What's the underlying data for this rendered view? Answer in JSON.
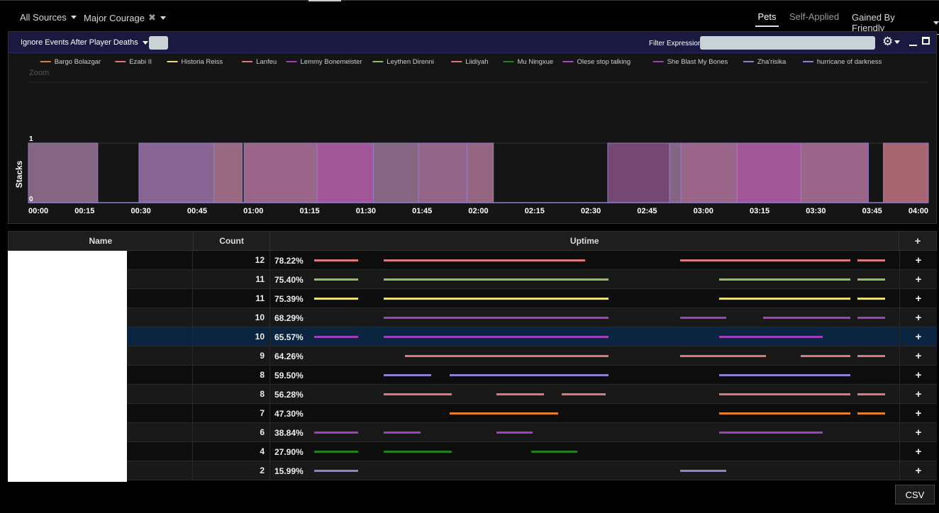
{
  "topbar": {
    "sources_label": "All Sources",
    "aura_label": "Major Courage",
    "tab_pets": "Pets",
    "tab_self_applied": "Self-Applied",
    "gained_label": "Gained By Friendly"
  },
  "panel": {
    "ignore_label": "Ignore Events After Player Deaths",
    "filter_label": "Filter Expression:",
    "filter_value": ""
  },
  "chart_data": {
    "type": "area",
    "zoom_label": "Zoom",
    "ylabel": "Stacks",
    "ylim": [
      0,
      1
    ],
    "y_ticks": [
      "0",
      "1"
    ],
    "xlim": [
      0,
      240
    ],
    "x_ticks": [
      "00:00",
      "00:15",
      "00:30",
      "00:45",
      "01:00",
      "01:15",
      "01:30",
      "01:45",
      "02:00",
      "02:15",
      "02:30",
      "02:45",
      "03:00",
      "03:15",
      "03:30",
      "03:45",
      "04:00"
    ],
    "legend": [
      {
        "name": "Bargo Bolazgar",
        "color": "#e08030"
      },
      {
        "name": "Ezabi II",
        "color": "#e07878"
      },
      {
        "name": "Historia Reiss",
        "color": "#e8e070"
      },
      {
        "name": "Lanfeu",
        "color": "#e07878"
      },
      {
        "name": "Lemmy Bonemeister",
        "color": "#a040c0"
      },
      {
        "name": "Leythen Direnni",
        "color": "#90c060"
      },
      {
        "name": "Liidiyah",
        "color": "#e07878"
      },
      {
        "name": "Mu Ningxue",
        "color": "#208020"
      },
      {
        "name": "Olese stop talking",
        "color": "#b040d0"
      },
      {
        "name": "She Blast My Bones",
        "color": "#a040c0"
      },
      {
        "name": "Zha'risika",
        "color": "#9080d0"
      },
      {
        "name": "hurricane of darkness",
        "color": "#9080d0"
      }
    ],
    "blocks": [
      {
        "start": 0,
        "end": 18.5,
        "color": "#8a6a88"
      },
      {
        "start": 29.5,
        "end": 57,
        "color": "#8e6a9a"
      },
      {
        "start": 49.5,
        "end": 57,
        "color": "#9a6a80"
      },
      {
        "start": 57.5,
        "end": 77,
        "color": "#a06a90"
      },
      {
        "start": 77,
        "end": 92,
        "color": "#a85a9e"
      },
      {
        "start": 92,
        "end": 104,
        "color": "#8a6a88"
      },
      {
        "start": 104,
        "end": 117,
        "color": "#9a6a8e"
      },
      {
        "start": 117,
        "end": 124,
        "color": "#9c6a88"
      },
      {
        "start": 154.5,
        "end": 171,
        "color": "#7a4a78"
      },
      {
        "start": 171,
        "end": 174,
        "color": "#8a6a88"
      },
      {
        "start": 174,
        "end": 189,
        "color": "#a06a90"
      },
      {
        "start": 189,
        "end": 206,
        "color": "#a85a9e"
      },
      {
        "start": 206,
        "end": 224,
        "color": "#a06a90"
      },
      {
        "start": 228,
        "end": 240,
        "color": "#b06a78"
      }
    ]
  },
  "table": {
    "headers": {
      "name": "Name",
      "count": "Count",
      "uptime": "Uptime",
      "plus": "+"
    },
    "rows": [
      {
        "count": "12",
        "uptime": "78.22%",
        "color": "#e07878",
        "segments": [
          [
            0,
            0.076
          ],
          [
            0.12,
            0.466
          ],
          [
            0.629,
            0.922
          ],
          [
            0.934,
            0.982
          ]
        ]
      },
      {
        "count": "11",
        "uptime": "75.40%",
        "color": "#90c060",
        "segments": [
          [
            0,
            0.076
          ],
          [
            0.12,
            0.506
          ],
          [
            0.696,
            0.922
          ],
          [
            0.934,
            0.982
          ]
        ]
      },
      {
        "count": "11",
        "uptime": "75.39%",
        "color": "#e8e070",
        "segments": [
          [
            0,
            0.076
          ],
          [
            0.12,
            0.506
          ],
          [
            0.696,
            0.922
          ],
          [
            0.934,
            0.982
          ]
        ]
      },
      {
        "count": "10",
        "uptime": "68.29%",
        "color": "#a040c0",
        "segments": [
          [
            0.12,
            0.506
          ],
          [
            0.629,
            0.709
          ],
          [
            0.772,
            0.922
          ],
          [
            0.934,
            0.982
          ]
        ]
      },
      {
        "count": "10",
        "uptime": "65.57%",
        "color": "#a040c0",
        "segments": [
          [
            0,
            0.076
          ],
          [
            0.12,
            0.506
          ],
          [
            0.696,
            0.875
          ]
        ]
      },
      {
        "count": "9",
        "uptime": "64.26%",
        "color": "#e07878",
        "segments": [
          [
            0.156,
            0.506
          ],
          [
            0.629,
            0.777
          ],
          [
            0.836,
            0.922
          ],
          [
            0.934,
            0.982
          ]
        ]
      },
      {
        "count": "8",
        "uptime": "59.50%",
        "color": "#9080d0",
        "segments": [
          [
            0.12,
            0.201
          ],
          [
            0.233,
            0.506
          ],
          [
            0.696,
            0.922
          ]
        ]
      },
      {
        "count": "8",
        "uptime": "56.28%",
        "color": "#e07878",
        "segments": [
          [
            0.12,
            0.237
          ],
          [
            0.314,
            0.395
          ],
          [
            0.426,
            0.501
          ],
          [
            0.696,
            0.922
          ],
          [
            0.934,
            0.982
          ]
        ]
      },
      {
        "count": "7",
        "uptime": "47.30%",
        "color": "#e08030",
        "segments": [
          [
            0.233,
            0.42
          ],
          [
            0.696,
            0.922
          ],
          [
            0.934,
            0.982
          ]
        ]
      },
      {
        "count": "6",
        "uptime": "38.84%",
        "color": "#a040c0",
        "segments": [
          [
            0,
            0.076
          ],
          [
            0.12,
            0.183
          ],
          [
            0.314,
            0.376
          ],
          [
            0.696,
            0.875
          ]
        ]
      },
      {
        "count": "4",
        "uptime": "27.90%",
        "color": "#208020",
        "segments": [
          [
            0,
            0.076
          ],
          [
            0.12,
            0.237
          ],
          [
            0.373,
            0.453
          ]
        ]
      },
      {
        "count": "2",
        "uptime": "15.99%",
        "color": "#9080d0",
        "segments": [
          [
            0,
            0.076
          ],
          [
            0.629,
            0.709
          ]
        ]
      }
    ]
  },
  "csv_label": "CSV"
}
